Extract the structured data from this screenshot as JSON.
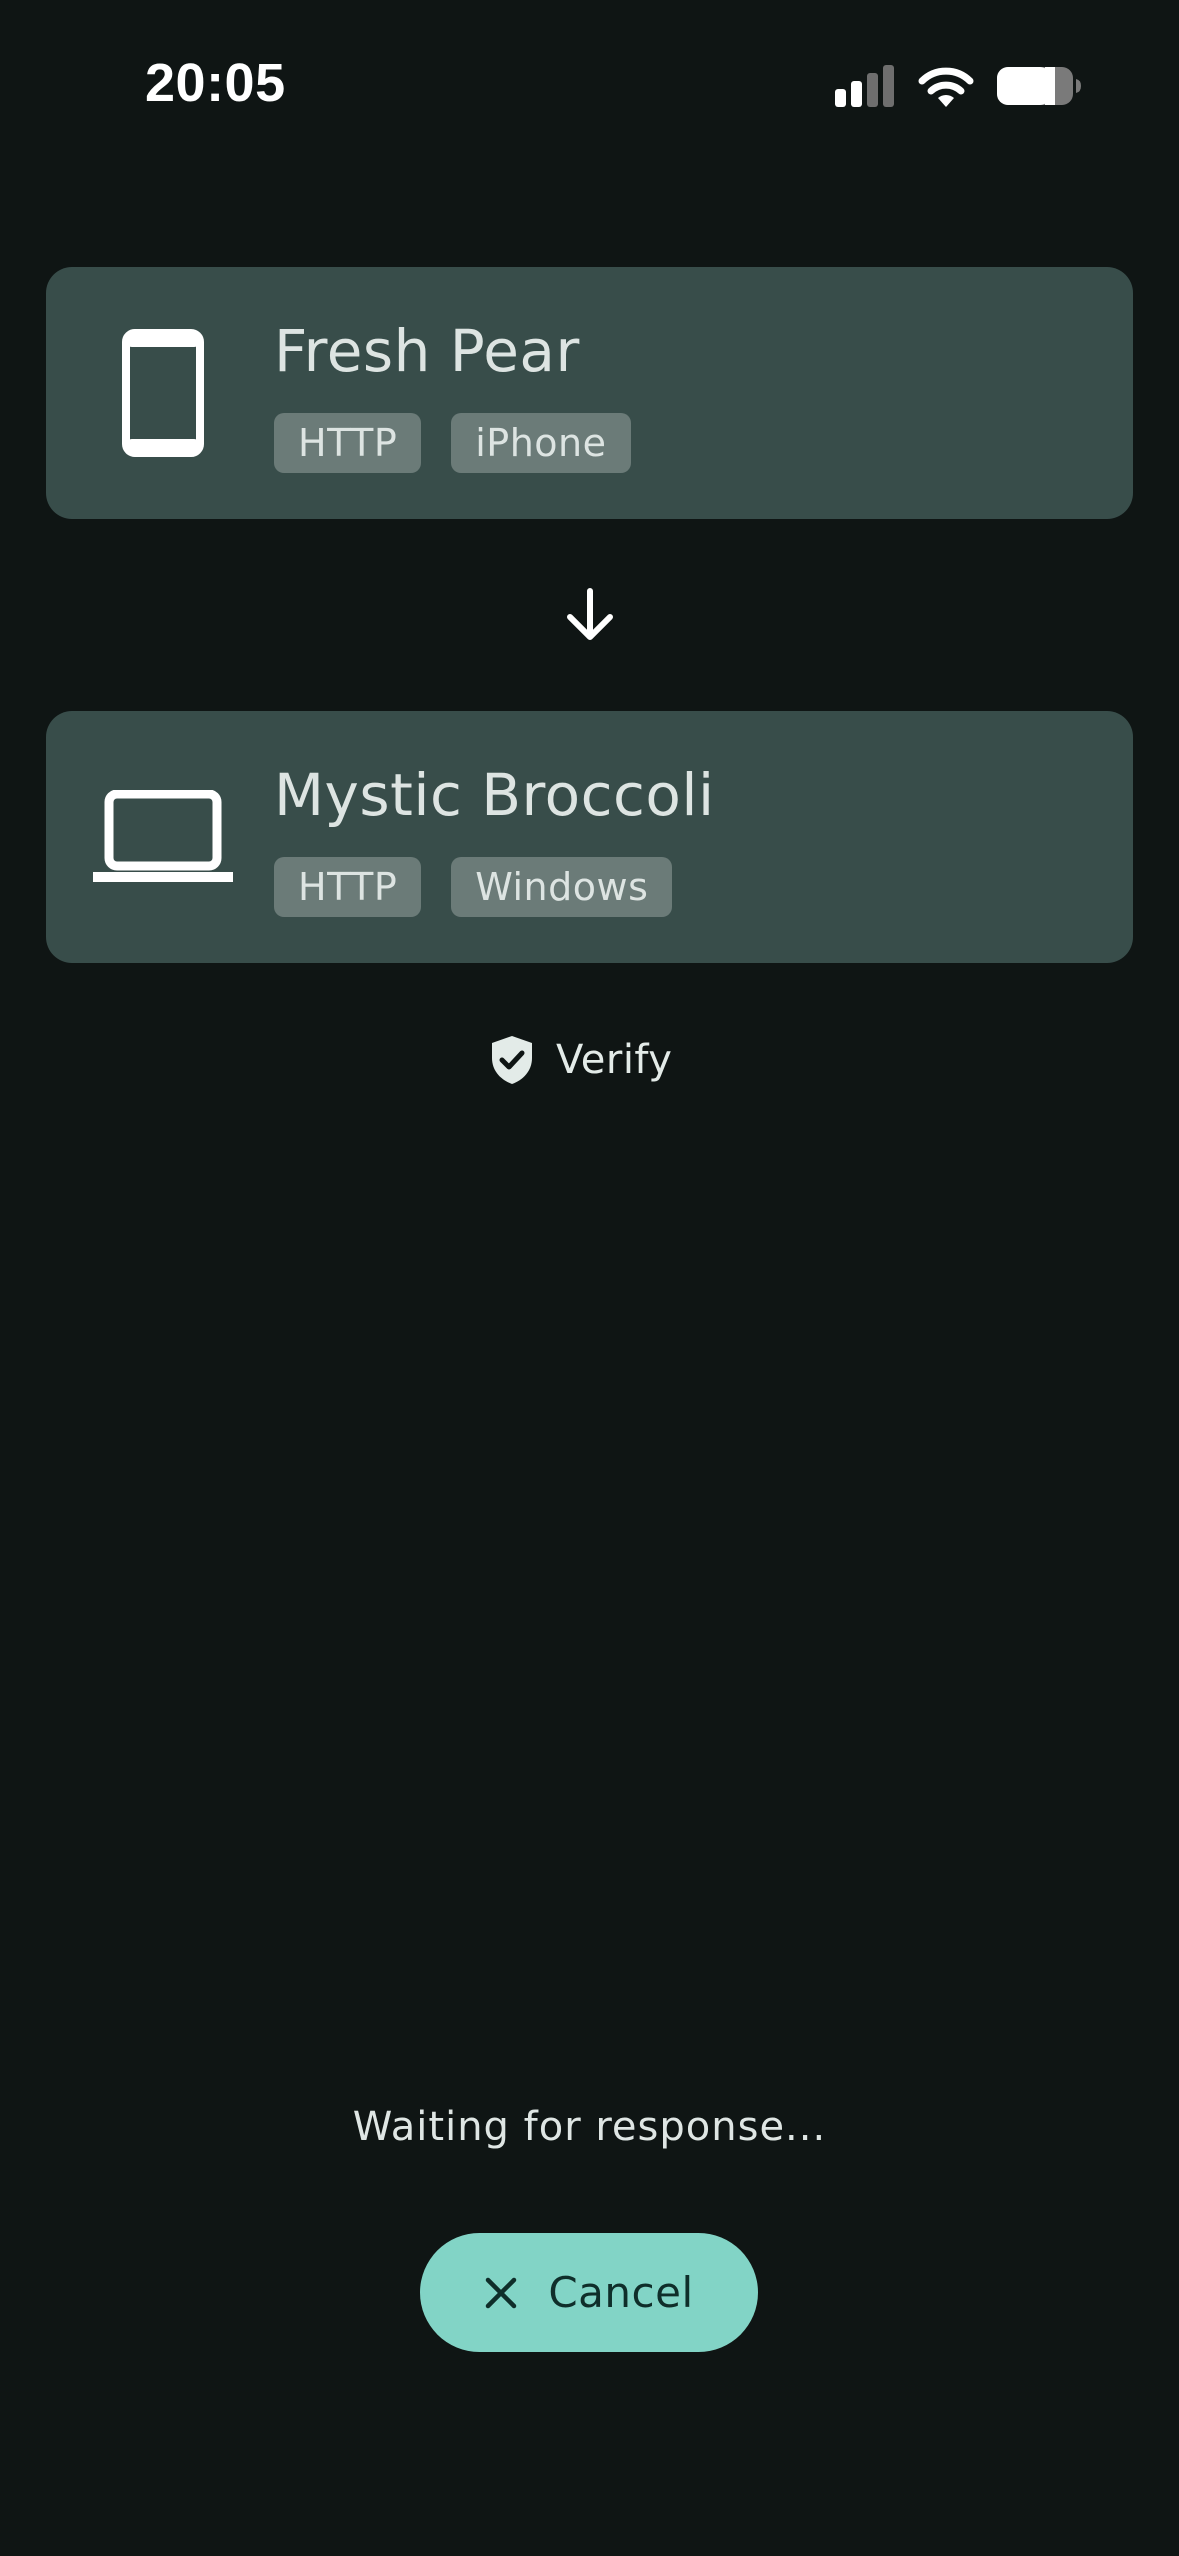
{
  "status_bar": {
    "time": "20:05",
    "icons": [
      "cellular-signal-icon",
      "wifi-icon",
      "battery-icon"
    ]
  },
  "sender": {
    "name": "Fresh Pear",
    "icon": "phone-icon",
    "tags": [
      "HTTP",
      "iPhone"
    ]
  },
  "direction_icon": "arrow-down-icon",
  "receiver": {
    "name": "Mystic Broccoli",
    "icon": "laptop-icon",
    "tags": [
      "HTTP",
      "Windows"
    ]
  },
  "verify": {
    "icon": "shield-check-icon",
    "label": "Verify"
  },
  "status_message": "Waiting for response...",
  "cancel_button": {
    "icon": "close-icon",
    "label": "Cancel"
  },
  "colors": {
    "background": "#0f1514",
    "card": "#384d4a",
    "tag": "#6b7b78",
    "accent": "#82d4c6"
  }
}
